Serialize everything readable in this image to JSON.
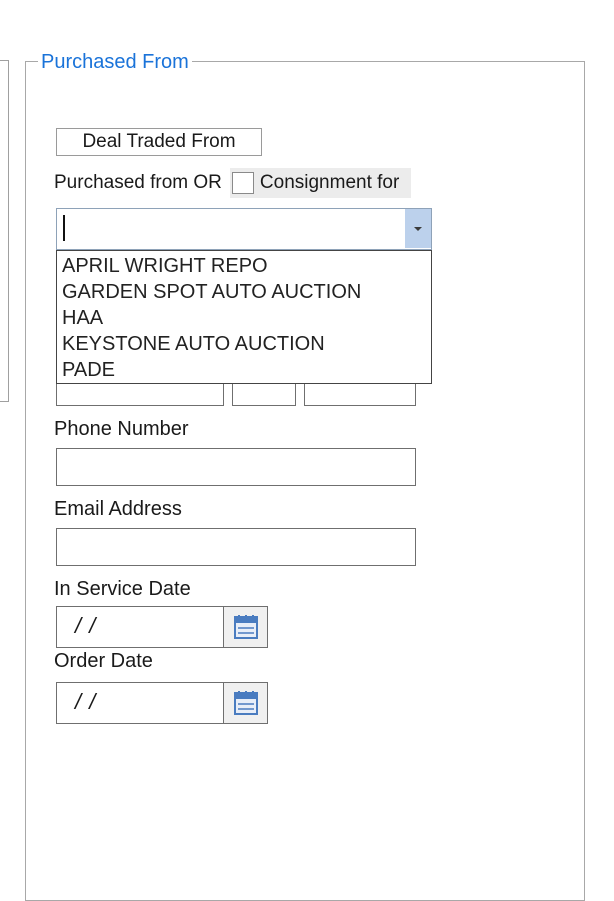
{
  "group": {
    "legend": "Purchased From"
  },
  "deal_traded_button": {
    "label": "Deal Traded From"
  },
  "purchased_row": {
    "label": "Purchased from OR",
    "consignment_label": "Consignment for",
    "consignment_checked": false
  },
  "vendor_combo": {
    "value": "",
    "options": [
      "APRIL WRIGHT REPO",
      "GARDEN SPOT AUTO AUCTION",
      "HAA",
      "KEYSTONE AUTO AUCTION",
      "PADE"
    ]
  },
  "phone": {
    "label": "Phone Number",
    "value": ""
  },
  "email": {
    "label": "Email Address",
    "value": ""
  },
  "in_service_date": {
    "label": "In Service Date",
    "value": " /  /"
  },
  "order_date": {
    "label": "Order Date",
    "value": " /  /"
  },
  "icons": {
    "combo_arrow": "chevron-down-icon",
    "calendar": "calendar-icon"
  },
  "colors": {
    "legend": "#1a73d9",
    "combo_border": "#8ea2b8",
    "combo_arrow_bg": "#bcd1ec",
    "calendar_blue": "#4a7cc0"
  }
}
